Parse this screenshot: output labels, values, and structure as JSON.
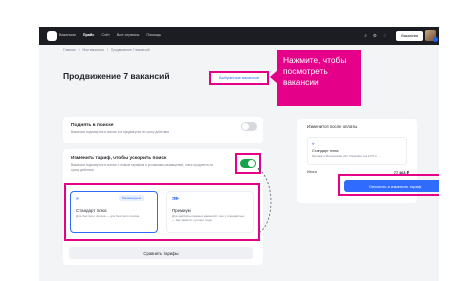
{
  "header": {
    "nav": [
      "Вакансии",
      "Прайс",
      "Счёт",
      "Все сервисы",
      "Помощь"
    ],
    "active_nav": "Прайс",
    "vacancies_button": "Вакансии",
    "icons": [
      "search-icon",
      "settings-icon",
      "bell-icon"
    ]
  },
  "breadcrumbs": [
    "Главная",
    "Мои вакансии",
    "Продвижение 7 вакансий"
  ],
  "page": {
    "title": "Продвижение 7 вакансий",
    "selected_link": "Выбранные вакансии"
  },
  "options": [
    {
      "title": "Поднять в поиске",
      "description": "Вакансии поднимутся в поиске и в продвигутся по сроку действия",
      "enabled": false
    },
    {
      "title": "Изменить тариф, чтобы ускорить поиск",
      "description": "Вакансии поднимутся в поиске с новым тарифом и условиями размещения, плюс продлятся по сроку действия",
      "enabled": true
    }
  ],
  "tariffs": [
    {
      "name": "Стандарт плюс",
      "tag": "Рекомендуем",
      "description": "Для быстрого поиска — для быстрого поиска",
      "selected": true
    },
    {
      "name": "Премиум",
      "tag": "",
      "description": "Для наиболее важных вакансий, чем у стандартных — вас заметят лучшие люди",
      "selected": false
    }
  ],
  "compare_button": "Сравнить тарифы",
  "summary": {
    "title": "Изменится после оплаты",
    "item_title": "Стандарт плюс",
    "item_description": "Москва и Московская обл. Разработчик в ИТ и ...",
    "total_label": "Итого",
    "total_value": "77 463 ₽"
  },
  "pay_button": "Оплатить и изменить тариф",
  "callout": "Нажмите, чтобы посмотреть вакансии",
  "colors": {
    "accent_magenta": "#e5008a",
    "primary_blue": "#2f6bff",
    "toggle_green": "#16a34a",
    "topbar": "#1b1d22"
  }
}
